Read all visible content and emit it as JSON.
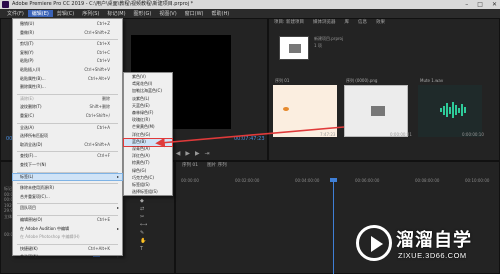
{
  "window": {
    "title": "Adobe Premiere Pro CC 2019 - C:\\用户\\桌面\\教程\\视频教程\\新建项目.prproj *",
    "controls": [
      "–",
      "□",
      "✕"
    ]
  },
  "menubar": {
    "items": [
      "文件(F)",
      "编辑(E)",
      "剪辑(C)",
      "序列(S)",
      "标记(M)",
      "图形(G)",
      "视图(V)",
      "窗口(W)",
      "帮助(H)"
    ],
    "active_index": 1
  },
  "edit_menu": {
    "items": [
      {
        "label": "撤销(U)",
        "shortcut": "Ctrl+Z",
        "disabled": false
      },
      {
        "label": "重做(R)",
        "shortcut": "Ctrl+Shift+Z",
        "disabled": false
      },
      {
        "label": "剪切(T)",
        "shortcut": "Ctrl+X",
        "disabled": false
      },
      {
        "label": "复制(Y)",
        "shortcut": "Ctrl+C",
        "disabled": false
      },
      {
        "label": "粘贴(P)",
        "shortcut": "Ctrl+V",
        "disabled": false
      },
      {
        "label": "粘贴插入(I)",
        "shortcut": "Ctrl+Shift+V",
        "disabled": false
      },
      {
        "label": "粘贴属性(B)...",
        "shortcut": "Ctrl+Alt+V",
        "disabled": false
      },
      {
        "label": "删除属性(R)...",
        "shortcut": "",
        "disabled": false
      },
      {
        "label": "清除(E)",
        "shortcut": "删除",
        "disabled": true
      },
      {
        "label": "波纹删除(T)",
        "shortcut": "Shift+删除",
        "disabled": false
      },
      {
        "label": "重复(C)",
        "shortcut": "Ctrl+Shift+/",
        "disabled": false
      },
      {
        "label": "全选(A)",
        "shortcut": "Ctrl+A",
        "disabled": false
      },
      {
        "label": "选择所有匹配项",
        "shortcut": "",
        "disabled": false
      },
      {
        "label": "取消全选(D)",
        "shortcut": "Ctrl+Shift+A",
        "disabled": false
      },
      {
        "label": "查找(F)...",
        "shortcut": "Ctrl+F",
        "disabled": false
      },
      {
        "label": "查找下一个(N)",
        "shortcut": "",
        "disabled": false
      },
      {
        "label": "标签(L)",
        "shortcut": "",
        "disabled": false,
        "submenu": true
      },
      {
        "label": "移除未使用资源(R)",
        "shortcut": "",
        "disabled": false
      },
      {
        "label": "合并重复项(C)...",
        "shortcut": "",
        "disabled": false
      },
      {
        "label": "团队项目",
        "shortcut": "",
        "disabled": false,
        "submenu": true
      },
      {
        "label": "编辑原始(O)",
        "shortcut": "Ctrl+E",
        "disabled": false
      },
      {
        "label": "在 Adobe Audition 中编辑",
        "shortcut": "",
        "disabled": false,
        "submenu": true
      },
      {
        "label": "在 Adobe Photoshop 中编辑(H)",
        "shortcut": "",
        "disabled": true
      },
      {
        "label": "快捷键(K)",
        "shortcut": "Ctrl+Alt+K",
        "disabled": false
      },
      {
        "label": "首选项(N)",
        "shortcut": "",
        "disabled": false,
        "submenu": true
      }
    ],
    "highlight_index": 16
  },
  "label_submenu": {
    "items": [
      "紫色(V)",
      "鸢尾花色(I)",
      "加勒比海蓝色(C)",
      "淡紫色(L)",
      "天蓝色(E)",
      "森林绿色(F)",
      "玫瑰红(R)",
      "芒果黄色(M)",
      "洋红色(G)",
      "蓝色(B)",
      "深青色(A)",
      "洋红色(A)",
      "棕黄色(T)",
      "绿色(G)",
      "巧克力色(C)",
      "标签组(S)",
      "选择标签组(S)"
    ],
    "highlight_index": 9
  },
  "program_monitor": {
    "timecode_left": "00:00:00:00",
    "timecode_right": "00:07:47:23",
    "controls": [
      "{",
      "}",
      "⇤",
      "◀",
      "▶",
      "▶",
      "⇥",
      "⎘",
      "⊡",
      "📷",
      "+"
    ]
  },
  "project_panel": {
    "tabs": [
      "项目: 新建项目",
      "媒体浏览器",
      "库",
      "信息",
      "效果"
    ],
    "bin_label": "新建项目.prproj",
    "item_count": "1 项",
    "clips": [
      {
        "name": "序列 01",
        "duration": "7:47:23"
      },
      {
        "name": "序列 (0000).png",
        "duration": "0:00:00:01"
      },
      {
        "name": "Mute 1.wav",
        "duration": "0:00:00:10"
      }
    ]
  },
  "timeline": {
    "tabs": [
      "序列 01",
      "图片 序列"
    ],
    "ruler_labels": [
      "00:00:00",
      "00:02:00:00",
      "00:04:00:00",
      "00:06:00:00",
      "00:08:00:00",
      "00:10:00:00"
    ],
    "tracks": [
      "V3",
      "V2",
      "V1",
      "A1",
      "A2",
      "A3"
    ],
    "tools": [
      "▸",
      "⇔",
      "◆",
      "⇄",
      "✂",
      "⟷",
      "✎",
      "✋",
      "T"
    ]
  },
  "left_info": {
    "lines": [
      "标记",
      "00:00:00:00",
      "00:07:47:23",
      "1920 x 1080 (1.0)",
      "29.97 fps",
      "立体声",
      "00:00:00:00"
    ]
  },
  "watermark": {
    "brand": "溜溜自学",
    "url": "ZIXUE.3D66.COM"
  },
  "colors": {
    "accent_blue": "#3f7fd6",
    "menu_highlight": "#cfe3f7",
    "arrow_red": "#e03a3a",
    "wave_green": "#2ecc9a"
  }
}
